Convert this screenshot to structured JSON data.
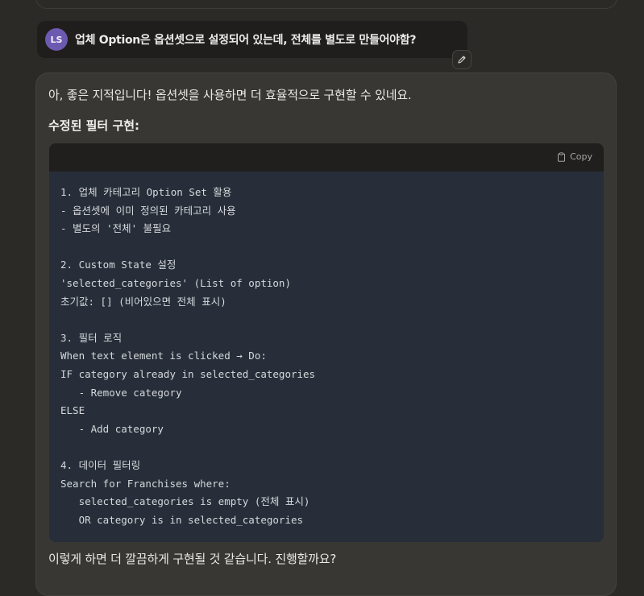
{
  "user_message": {
    "avatar_initials": "LS",
    "text": "업체 Option은 옵션셋으로 설정되어 있는데, 전체를 별도로 만들어야함?"
  },
  "edit_button_icon": "pencil-icon",
  "assistant_message": {
    "intro": "아, 좋은 지적입니다! 옵션셋을 사용하면 더 효율적으로 구현할 수 있네요.",
    "heading": "수정된 필터 구현:",
    "code_block": {
      "copy_label": "Copy",
      "copy_icon": "clipboard-icon",
      "lines": [
        "1. 업체 카테고리 Option Set 활용",
        "- 옵션셋에 이미 정의된 카테고리 사용",
        "- 별도의 '전체' 불필요",
        "",
        "2. Custom State 설정",
        "'selected_categories' (List of option)",
        "초기값: [] (비어있으면 전체 표시)",
        "",
        "3. 필터 로직",
        "When text element is clicked → Do:",
        "IF category already in selected_categories",
        "   - Remove category",
        "ELSE",
        "   - Add category",
        "",
        "4. 데이터 필터링",
        "Search for Franchises where:",
        "   selected_categories is empty (전체 표시)",
        "   OR category is in selected_categories"
      ]
    },
    "outro": "이렇게 하면 더 깔끔하게 구현될 것 같습니다. 진행할까요?"
  },
  "colors": {
    "background": "#2b2a27",
    "assistant_card": "#383733",
    "user_bubble": "#1f1e1c",
    "avatar": "#6c5ab0",
    "code_background": "#272e39",
    "code_header": "#201f1d"
  }
}
